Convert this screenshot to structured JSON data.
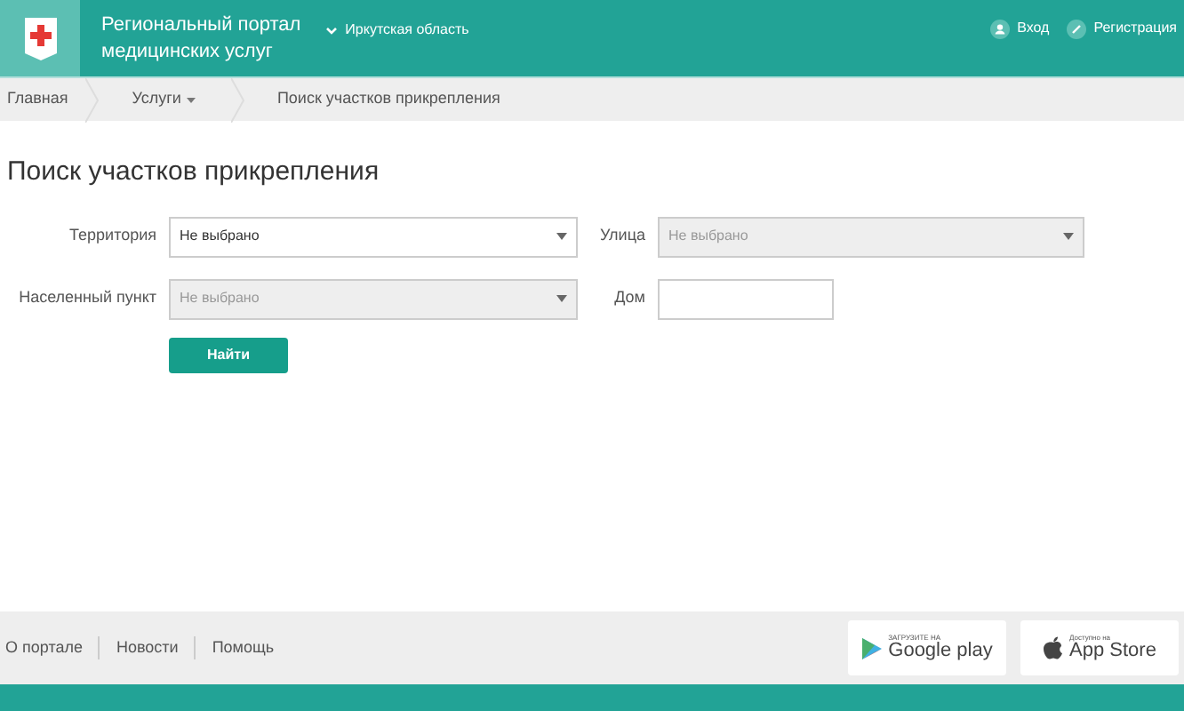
{
  "header": {
    "title_line1": "Региональный портал",
    "title_line2": "медицинских услуг",
    "region": "Иркутская область",
    "links": [
      {
        "label": "Вход",
        "kind": "login"
      },
      {
        "label": "Регистрация",
        "kind": "register"
      }
    ]
  },
  "breadcrumbs": [
    {
      "label": "Главная",
      "dropdown": false
    },
    {
      "label": "Услуги",
      "dropdown": true
    },
    {
      "label": "Поиск участков прикрепления",
      "dropdown": false
    }
  ],
  "page_title": "Поиск участков прикрепления",
  "fields": [
    {
      "label": "Территория",
      "kind": "select",
      "value": "Не выбрано",
      "disabled": false
    },
    {
      "label": "Улица",
      "kind": "select",
      "value": "Не выбрано",
      "disabled": true
    },
    {
      "label": "Населенный пункт",
      "kind": "select",
      "value": "Не выбрано",
      "disabled": true
    },
    {
      "label": "Дом",
      "kind": "input",
      "disabled": false
    }
  ],
  "search_button": "Найти",
  "footer": {
    "links": [
      "О портале",
      "Новости",
      "Помощь"
    ],
    "stores": [
      {
        "kind": "google",
        "small": "ЗАГРУЗИТЕ НА",
        "big": "Google play"
      },
      {
        "kind": "apple",
        "small": "Доступно на",
        "big": "App Store"
      }
    ]
  }
}
